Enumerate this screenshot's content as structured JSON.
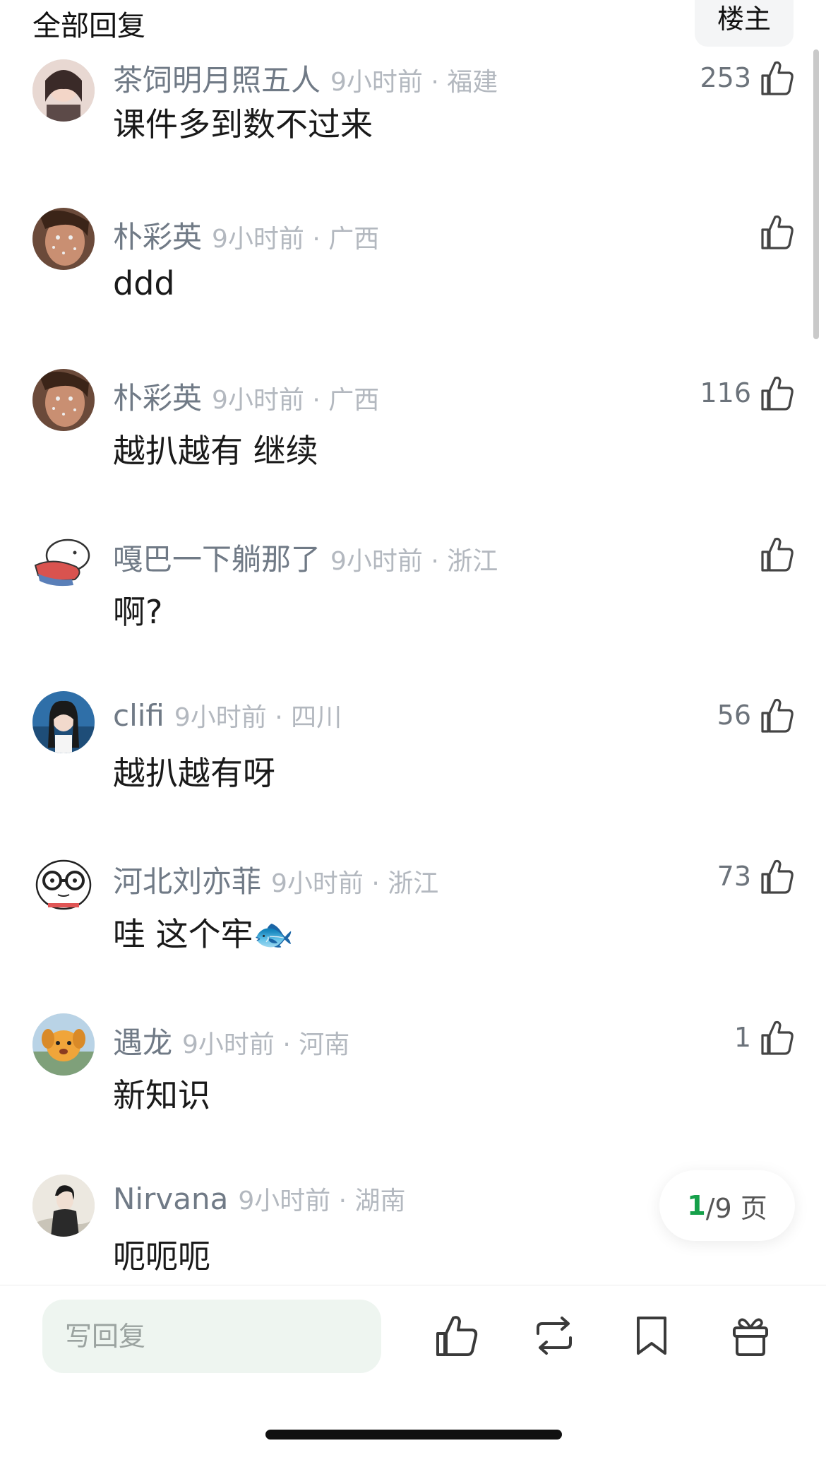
{
  "header": {
    "title": "全部回复",
    "owner_label": "楼主"
  },
  "comments": [
    {
      "username": "茶饲明月照五人",
      "time_loc": "9小时前 · 福建",
      "content": "课件多到数不过来",
      "likes": "253"
    },
    {
      "username": "朴彩英",
      "time_loc": "9小时前 · 广西",
      "content": "ddd",
      "likes": ""
    },
    {
      "username": "朴彩英",
      "time_loc": "9小时前 · 广西",
      "content": "越扒越有 继续",
      "likes": "116"
    },
    {
      "username": "嘎巴一下躺那了",
      "time_loc": "9小时前 · 浙江",
      "content": "啊?",
      "likes": ""
    },
    {
      "username": "clifi",
      "time_loc": "9小时前 · 四川",
      "content": "越扒越有呀",
      "likes": "56"
    },
    {
      "username": "河北刘亦菲",
      "time_loc": "9小时前 · 浙江",
      "content": "哇 这个牢🐟",
      "likes": "73"
    },
    {
      "username": "遇龙",
      "time_loc": "9小时前 · 河南",
      "content": "新知识",
      "likes": "1"
    },
    {
      "username": "Nirvana",
      "time_loc": "9小时前 · 湖南",
      "content": "呃呃呃",
      "likes": ""
    }
  ],
  "pager": {
    "current": "1",
    "rest": "/9 页"
  },
  "bottom": {
    "reply_placeholder": "写回复"
  },
  "colors": {
    "accent": "#15a04a",
    "username": "#707a86",
    "meta": "#b3b8bf"
  }
}
